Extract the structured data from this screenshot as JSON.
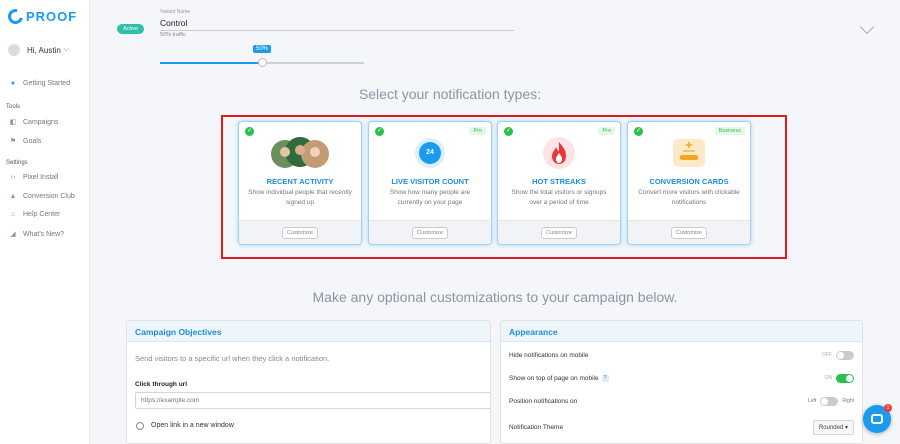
{
  "brand": "PROOF",
  "user": {
    "greeting": "Hi, Austin",
    "chevron": "⌵"
  },
  "sidebar": {
    "getting_started": "Getting Started",
    "tools_header": "Tools",
    "campaigns": "Campaigns",
    "goals": "Goals",
    "settings_header": "Settings",
    "pixel_install": "Pixel Install",
    "conversion_club": "Conversion Club",
    "help_center": "Help Center",
    "whats_new": "What's New?"
  },
  "variant": {
    "status": "Active",
    "name_label": "Variant Name",
    "name": "Control",
    "traffic": "50% traffic",
    "slider_label": "50%",
    "slider_value": 0.5
  },
  "notifications": {
    "title": "Select your notification types:",
    "cards": [
      {
        "title": "RECENT ACTIVITY",
        "desc": "Show individual people that recently signed up",
        "tier": "",
        "button": "Customize",
        "icon": "people-photos-icon"
      },
      {
        "title": "LIVE VISITOR COUNT",
        "desc": "Show how many people are currently on your page",
        "tier": "Pro",
        "button": "Customize",
        "icon": "visitor-count-icon",
        "count": "24"
      },
      {
        "title": "HOT STREAKS",
        "desc": "Show the total visitors or signups over a period of time",
        "tier": "Pro",
        "button": "Customize",
        "icon": "flame-icon"
      },
      {
        "title": "CONVERSION CARDS",
        "desc": "Convert more visitors with clickable notifications",
        "tier": "Business",
        "button": "Customize",
        "icon": "card-icon"
      }
    ]
  },
  "customizations": {
    "title": "Make any optional customizations to your campaign below."
  },
  "objectives": {
    "title": "Campaign Objectives",
    "text": "Send visitors to a specific url when they click a notification.",
    "url_label": "Click through url",
    "url_placeholder": "https://example.com",
    "new_window": "Open link in a new window"
  },
  "appearance": {
    "title": "Appearance",
    "hide_mobile": "Hide notifications on mobile",
    "hide_mobile_state": "OFF",
    "top_mobile": "Show on top of page on mobile",
    "top_mobile_state": "ON",
    "position": "Position notifications on",
    "left": "Left",
    "right": "Right",
    "theme": "Notification Theme",
    "theme_value": "Rounded"
  },
  "chat": {
    "unread": "1"
  },
  "colors": {
    "accent": "#1a9bf0",
    "success": "#2bbf4e",
    "highlight": "#e01b1b"
  }
}
